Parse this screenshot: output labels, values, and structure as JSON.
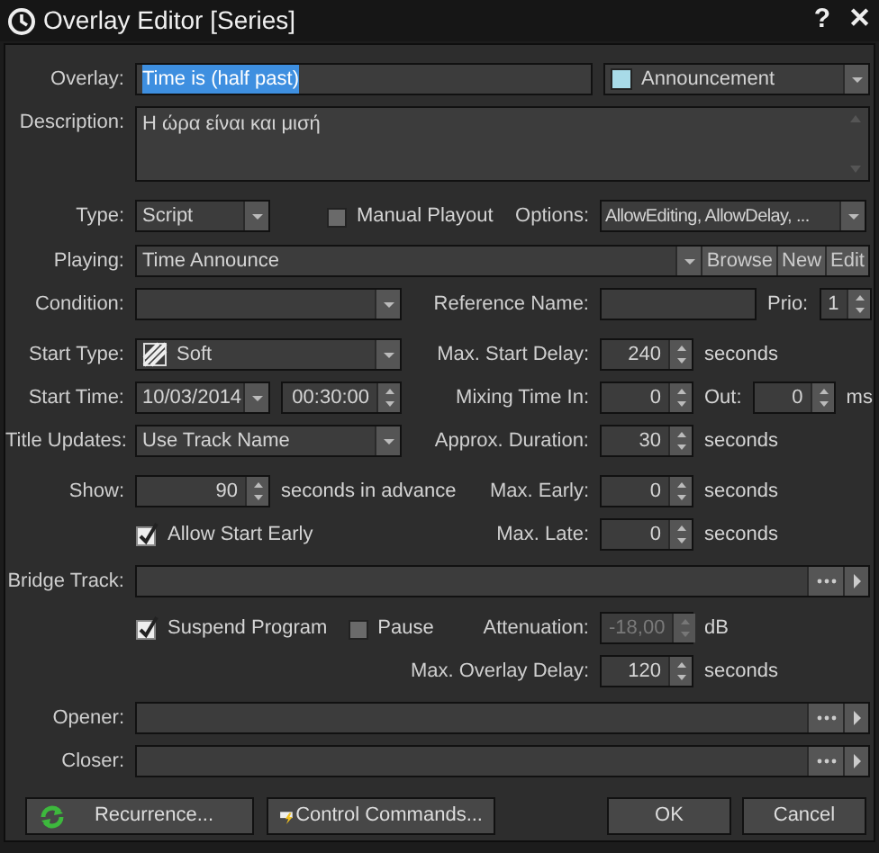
{
  "window": {
    "title": "Overlay Editor [Series]",
    "help": "?",
    "close": "✕"
  },
  "overlay": {
    "label": "Overlay:",
    "value": "Time is (half past)",
    "text_selected": true,
    "category": {
      "value": "Announcement",
      "color": "#a8dbe8"
    }
  },
  "description": {
    "label": "Description:",
    "value": "Η ώρα είναι και μισή"
  },
  "type": {
    "label": "Type:",
    "value": "Script"
  },
  "manual_playout": {
    "label": "Manual Playout",
    "checked": false
  },
  "options": {
    "label": "Options:",
    "value": "AllowEditing, AllowDelay, ..."
  },
  "playing": {
    "label": "Playing:",
    "value": "Time Announce",
    "buttons": [
      "Browse",
      "New",
      "Edit"
    ]
  },
  "condition": {
    "label": "Condition:"
  },
  "reference_name": {
    "label": "Reference Name:"
  },
  "prio": {
    "label": "Prio:",
    "value": "1"
  },
  "start_type": {
    "label": "Start Type:",
    "value": "Soft"
  },
  "max_start_delay": {
    "label": "Max. Start Delay:",
    "value": "240",
    "unit": "seconds"
  },
  "start_time": {
    "label": "Start Time:",
    "date": "10/03/2014",
    "time": "00:30:00"
  },
  "mixing_time": {
    "label": "Mixing Time In:",
    "in": "0",
    "out_label": "Out:",
    "out": "0",
    "unit": "ms"
  },
  "title_updates": {
    "label": "Title Updates:",
    "value": "Use Track Name"
  },
  "approx_duration": {
    "label": "Approx. Duration:",
    "value": "30",
    "unit": "seconds"
  },
  "show": {
    "label": "Show:",
    "value": "90",
    "unit": "seconds in advance"
  },
  "max_early": {
    "label": "Max. Early:",
    "value": "0",
    "unit": "seconds"
  },
  "allow_start_early": {
    "label": "Allow Start Early",
    "checked": true
  },
  "max_late": {
    "label": "Max. Late:",
    "value": "0",
    "unit": "seconds"
  },
  "bridge_track": {
    "label": "Bridge Track:"
  },
  "suspend_program": {
    "label": "Suspend Program",
    "checked": true
  },
  "pause": {
    "label": "Pause",
    "checked": false
  },
  "attenuation": {
    "label": "Attenuation:",
    "value": "-18,00",
    "unit": "dB",
    "disabled": true
  },
  "max_overlay_delay": {
    "label": "Max. Overlay Delay:",
    "value": "120",
    "unit": "seconds"
  },
  "opener": {
    "label": "Opener:"
  },
  "closer": {
    "label": "Closer:"
  },
  "buttons": [
    {
      "label": "Recurrence...",
      "kind": "recurrence"
    },
    {
      "label": "Control Commands...",
      "kind": "commands"
    },
    {
      "label": "OK",
      "kind": "plain"
    },
    {
      "label": "Cancel",
      "kind": "plain"
    }
  ]
}
